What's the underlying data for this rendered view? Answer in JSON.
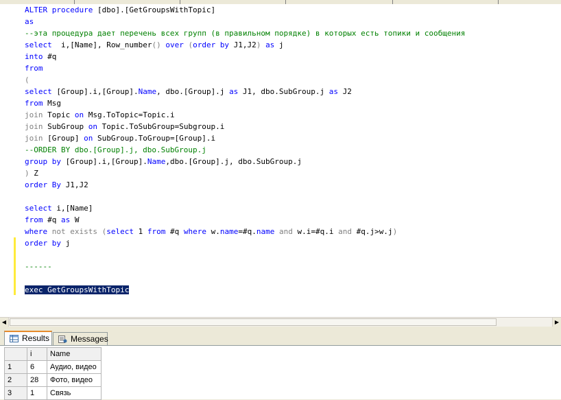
{
  "editor": {
    "lines": [
      [
        {
          "t": "ALTER procedure ",
          "c": "kw"
        },
        {
          "t": "[dbo].[GetGroupsWithTopic]",
          "c": "id"
        }
      ],
      [
        {
          "t": "as",
          "c": "kw"
        }
      ],
      [
        {
          "t": "--эта процедура дает перечень всех групп (в правильном порядке) в которых есть топики и сообщения",
          "c": "comment"
        }
      ],
      [
        {
          "t": "select",
          "c": "kw"
        },
        {
          "t": "  i,[Name], Row_number",
          "c": "id"
        },
        {
          "t": "()",
          "c": "gray"
        },
        {
          "t": " ",
          "c": "id"
        },
        {
          "t": "over",
          "c": "kw"
        },
        {
          "t": " (",
          "c": "gray"
        },
        {
          "t": "order by",
          "c": "kw"
        },
        {
          "t": " J1,J2",
          "c": "id"
        },
        {
          "t": ")",
          "c": "gray"
        },
        {
          "t": " ",
          "c": "id"
        },
        {
          "t": "as",
          "c": "kw"
        },
        {
          "t": " j",
          "c": "id"
        }
      ],
      [
        {
          "t": "into",
          "c": "kw"
        },
        {
          "t": " #q",
          "c": "id"
        }
      ],
      [
        {
          "t": "from",
          "c": "kw"
        }
      ],
      [
        {
          "t": "(",
          "c": "gray"
        }
      ],
      [
        {
          "t": "select",
          "c": "kw"
        },
        {
          "t": " [Group].i,[Group].",
          "c": "id"
        },
        {
          "t": "Name",
          "c": "kw"
        },
        {
          "t": ", dbo.[Group].j ",
          "c": "id"
        },
        {
          "t": "as",
          "c": "kw"
        },
        {
          "t": " J1, dbo.SubGroup.j ",
          "c": "id"
        },
        {
          "t": "as",
          "c": "kw"
        },
        {
          "t": " J2",
          "c": "id"
        }
      ],
      [
        {
          "t": "from",
          "c": "kw"
        },
        {
          "t": " Msg",
          "c": "id"
        }
      ],
      [
        {
          "t": "join",
          "c": "gray"
        },
        {
          "t": " Topic ",
          "c": "id"
        },
        {
          "t": "on",
          "c": "kw"
        },
        {
          "t": " Msg.ToTopic=Topic.i",
          "c": "id"
        }
      ],
      [
        {
          "t": "join",
          "c": "gray"
        },
        {
          "t": " SubGroup ",
          "c": "id"
        },
        {
          "t": "on",
          "c": "kw"
        },
        {
          "t": " Topic.ToSubGroup=Subgroup.i",
          "c": "id"
        }
      ],
      [
        {
          "t": "join",
          "c": "gray"
        },
        {
          "t": " [Group] ",
          "c": "id"
        },
        {
          "t": "on",
          "c": "kw"
        },
        {
          "t": " SubGroup.ToGroup=[Group].i",
          "c": "id"
        }
      ],
      [
        {
          "t": "--ORDER BY dbo.[Group].j, dbo.SubGroup.j",
          "c": "comment"
        }
      ],
      [
        {
          "t": "group by",
          "c": "kw"
        },
        {
          "t": " [Group].i,[Group].",
          "c": "id"
        },
        {
          "t": "Name",
          "c": "kw"
        },
        {
          "t": ",dbo.[Group].j, dbo.SubGroup.j",
          "c": "id"
        }
      ],
      [
        {
          "t": ")",
          "c": "gray"
        },
        {
          "t": " Z",
          "c": "id"
        }
      ],
      [
        {
          "t": "order By",
          "c": "kw"
        },
        {
          "t": " J1,J2",
          "c": "id"
        }
      ],
      [],
      [
        {
          "t": "select",
          "c": "kw"
        },
        {
          "t": " i,[Name]",
          "c": "id"
        }
      ],
      [
        {
          "t": "from",
          "c": "kw"
        },
        {
          "t": " #q ",
          "c": "id"
        },
        {
          "t": "as",
          "c": "kw"
        },
        {
          "t": " W",
          "c": "id"
        }
      ],
      [
        {
          "t": "where",
          "c": "kw"
        },
        {
          "t": " not exists (",
          "c": "gray"
        },
        {
          "t": "select",
          "c": "kw"
        },
        {
          "t": " 1 ",
          "c": "id"
        },
        {
          "t": "from",
          "c": "kw"
        },
        {
          "t": " #q ",
          "c": "id"
        },
        {
          "t": "where",
          "c": "kw"
        },
        {
          "t": " w.",
          "c": "id"
        },
        {
          "t": "name",
          "c": "kw"
        },
        {
          "t": "=#q.",
          "c": "id"
        },
        {
          "t": "name",
          "c": "kw"
        },
        {
          "t": " ",
          "c": "id"
        },
        {
          "t": "and",
          "c": "gray"
        },
        {
          "t": " w.i=#q.i ",
          "c": "id"
        },
        {
          "t": "and",
          "c": "gray"
        },
        {
          "t": " #q.j>w.j",
          "c": "id"
        },
        {
          "t": ")",
          "c": "gray"
        }
      ],
      [
        {
          "t": "order by",
          "c": "kw"
        },
        {
          "t": " j",
          "c": "id"
        }
      ],
      [],
      [
        {
          "t": "------",
          "c": "comment"
        }
      ],
      [],
      [
        {
          "t": "exec GetGroupsWithTopic",
          "c": "sel"
        }
      ]
    ]
  },
  "results": {
    "tabs": [
      {
        "label": "Results",
        "icon": "grid-icon",
        "active": true
      },
      {
        "label": "Messages",
        "icon": "messages-icon",
        "active": false
      }
    ],
    "columns": [
      "i",
      "Name"
    ],
    "rows": [
      {
        "num": "1",
        "i": "6",
        "name": "Аудио, видео"
      },
      {
        "num": "2",
        "i": "28",
        "name": "Фото, видео"
      },
      {
        "num": "3",
        "i": "1",
        "name": "Связь"
      }
    ]
  },
  "colors": {
    "keyword": "#0000ff",
    "comment": "#008000",
    "operator": "#808080",
    "selection": "#0a246a",
    "change_bar": "#ffeb3b",
    "active_tab_accent": "#e68b2c"
  }
}
